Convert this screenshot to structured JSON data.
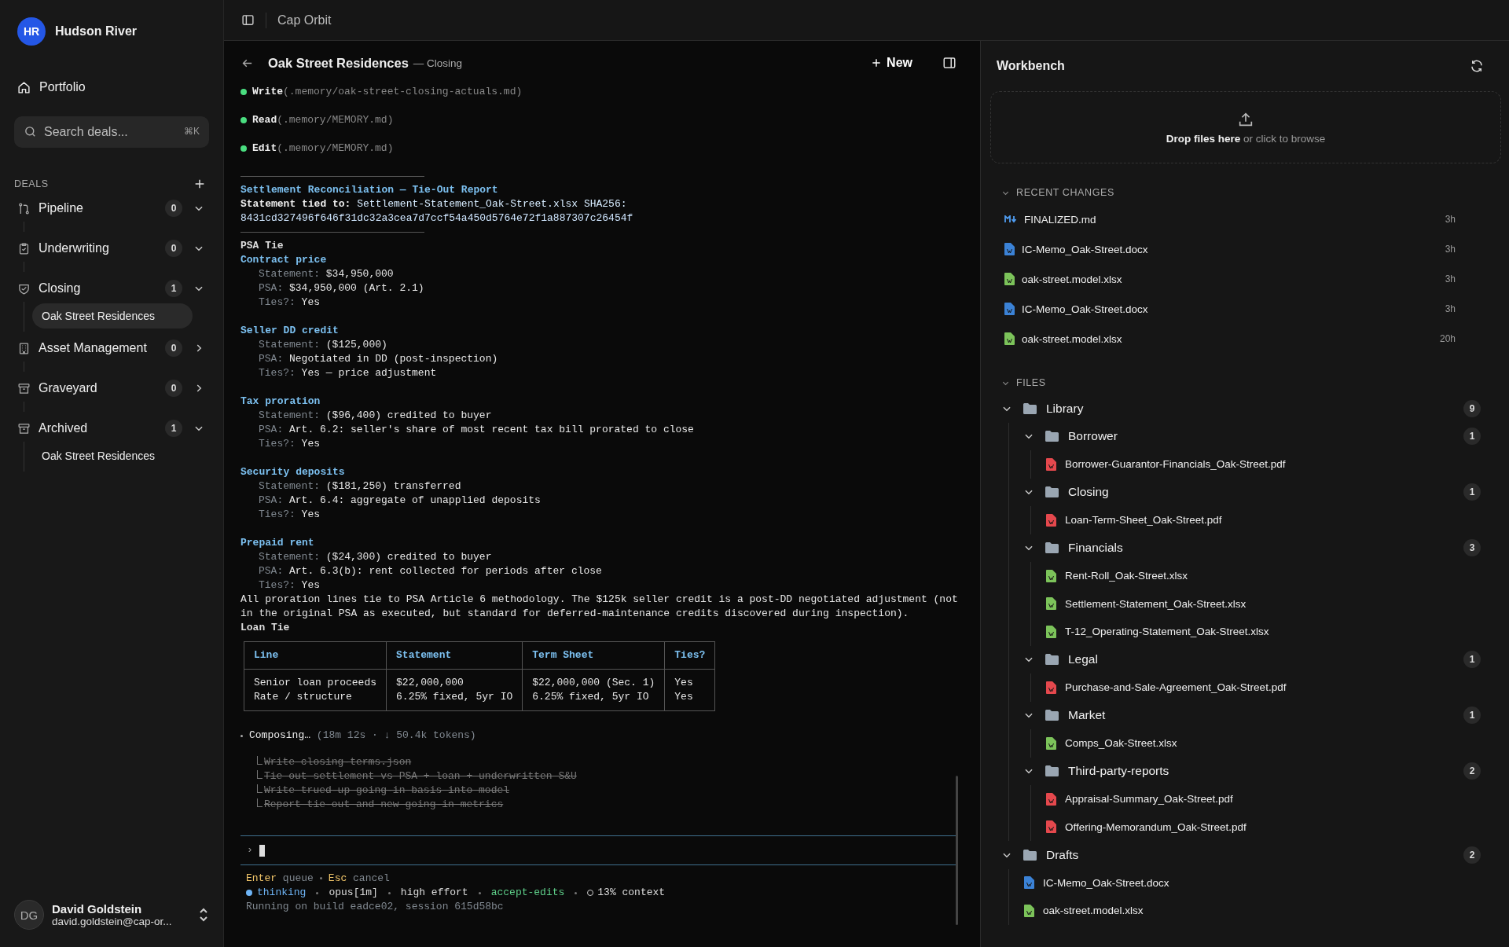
{
  "sidebar": {
    "org": {
      "initials": "HR",
      "name": "Hudson River"
    },
    "nav_item": "Portfolio",
    "search": {
      "placeholder": "Search deals...",
      "shortcut": "⌘K"
    },
    "deals": {
      "heading": "DEALS",
      "groups": [
        {
          "kind": "pipeline",
          "label": "Pipeline",
          "count": "0",
          "expanded": true
        },
        {
          "kind": "underwriting",
          "label": "Underwriting",
          "count": "0",
          "expanded": true
        },
        {
          "kind": "closing",
          "label": "Closing",
          "count": "1",
          "expanded": true,
          "children": [
            {
              "label": "Oak Street Residences",
              "selected": true
            }
          ]
        },
        {
          "kind": "asset",
          "label": "Asset Management",
          "count": "0",
          "expanded": false
        },
        {
          "kind": "graveyard",
          "label": "Graveyard",
          "count": "0",
          "expanded": false
        },
        {
          "kind": "archived",
          "label": "Archived",
          "count": "1",
          "expanded": true,
          "children": [
            {
              "label": "Oak Street Residences",
              "selected": false
            }
          ]
        }
      ]
    },
    "user": {
      "initials": "DG",
      "name": "David Goldstein",
      "email": "david.goldstein@cap-or..."
    }
  },
  "topbar": {
    "title": "Cap Orbit"
  },
  "chat": {
    "title": "Oak Street Residences",
    "subtitle": "— Closing",
    "new_button": "New",
    "tool_calls": [
      {
        "verb": "Write",
        "arg": "(.memory/oak-street-closing-actuals.md)"
      },
      {
        "verb": "Read",
        "arg": "(.memory/MEMORY.md)"
      },
      {
        "verb": "Edit",
        "arg": "(.memory/MEMORY.md)"
      }
    ],
    "report": [
      {
        "kind": "rule"
      },
      {
        "kind": "title",
        "text": "Settlement Reconciliation — Tie-Out Report"
      },
      {
        "kind": "meta",
        "label": "Statement tied to:",
        "value": "Settlement-Statement_Oak-Street.xlsx SHA256:"
      },
      {
        "kind": "hash",
        "text": "8431cd327496f646f31dc32a3cea7d7ccf54a450d5764e72f1a887307c26454f"
      },
      {
        "kind": "rule"
      },
      {
        "kind": "section",
        "text": "PSA Tie"
      },
      {
        "kind": "heading",
        "text": "Contract price"
      },
      {
        "kind": "field",
        "label": "Statement:",
        "value": "$34,950,000"
      },
      {
        "kind": "field",
        "label": "PSA:",
        "value": "$34,950,000 (Art. 2.1)"
      },
      {
        "kind": "field",
        "label": "Ties?:",
        "value": "Yes"
      },
      {
        "kind": "heading",
        "text": "Seller DD credit"
      },
      {
        "kind": "field",
        "label": "Statement:",
        "value": "($125,000)"
      },
      {
        "kind": "field",
        "label": "PSA:",
        "value": "Negotiated in DD (post-inspection)"
      },
      {
        "kind": "field",
        "label": "Ties?:",
        "value": "Yes — price adjustment"
      },
      {
        "kind": "heading",
        "text": "Tax proration"
      },
      {
        "kind": "field",
        "label": "Statement:",
        "value": "($96,400) credited to buyer"
      },
      {
        "kind": "field",
        "label": "PSA:",
        "value": "Art. 6.2: seller's share of most recent tax bill prorated to close"
      },
      {
        "kind": "field",
        "label": "Ties?:",
        "value": "Yes"
      },
      {
        "kind": "heading",
        "text": "Security deposits"
      },
      {
        "kind": "field",
        "label": "Statement:",
        "value": "($181,250) transferred"
      },
      {
        "kind": "field",
        "label": "PSA:",
        "value": "Art. 6.4: aggregate of unapplied deposits"
      },
      {
        "kind": "field",
        "label": "Ties?:",
        "value": "Yes"
      },
      {
        "kind": "heading",
        "text": "Prepaid rent"
      },
      {
        "kind": "field",
        "label": "Statement:",
        "value": "($24,300) credited to buyer"
      },
      {
        "kind": "field",
        "label": "PSA:",
        "value": "Art. 6.3(b): rent collected for periods after close"
      },
      {
        "kind": "field",
        "label": "Ties?:",
        "value": "Yes"
      },
      {
        "kind": "note",
        "text": "All proration lines tie to PSA Article 6 methodology. The $125k seller credit is a post-DD negotiated adjustment (not in the original PSA as executed, but standard for deferred-maintenance credits discovered during inspection)."
      },
      {
        "kind": "section",
        "text": "Loan Tie"
      }
    ],
    "table": {
      "columns": [
        "Line",
        "Statement",
        "Term Sheet",
        "Ties?"
      ],
      "rows": [
        [
          "Senior loan proceeds",
          "$22,000,000",
          "$22,000,000 (Sec. 1)",
          "Yes"
        ],
        [
          "Rate / structure",
          "6.25% fixed, 5yr IO",
          "6.25% fixed, 5yr IO",
          "Yes"
        ]
      ]
    },
    "progress": {
      "label": "Composing…",
      "detail": "(18m 12s · ↓ 50.4k tokens)",
      "tasks": [
        {
          "text": "Write closing-terms.json",
          "done": true
        },
        {
          "text": "Tie out settlement vs PSA + loan + underwritten S&U",
          "done": true
        },
        {
          "text": "Write trued-up going-in basis into model",
          "done": true
        },
        {
          "text": "Report tie-out and new going-in metrics",
          "done": true
        }
      ]
    },
    "prompt": {
      "symbol": "›"
    },
    "footer": {
      "hints": [
        {
          "key": "Enter",
          "action": "queue"
        },
        {
          "key": "Esc",
          "action": "cancel"
        }
      ],
      "status": [
        {
          "kind": "mode",
          "text": "thinking"
        },
        {
          "kind": "plain",
          "text": "opus[1m]"
        },
        {
          "kind": "plain",
          "text": "high effort"
        },
        {
          "kind": "accent",
          "text": "accept-edits"
        },
        {
          "kind": "context",
          "text": "13% context"
        }
      ],
      "build": "Running on build eadce02, session 615d58bc"
    }
  },
  "workbench": {
    "title": "Workbench",
    "dropzone": "**Drop files here** or click to browse",
    "recent": {
      "heading": "RECENT CHANGES",
      "expanded": true,
      "items": [
        {
          "kind": "md",
          "name": "FINALIZED.md",
          "time": "3h"
        },
        {
          "kind": "docx",
          "name": "IC-Memo_Oak-Street.docx",
          "time": "3h"
        },
        {
          "kind": "xlsx",
          "name": "oak-street.model.xlsx",
          "time": "3h"
        },
        {
          "kind": "docx",
          "name": "IC-Memo_Oak-Street.docx",
          "time": "3h"
        },
        {
          "kind": "xlsx",
          "name": "oak-street.model.xlsx",
          "time": "20h"
        }
      ]
    },
    "files": {
      "heading": "FILES",
      "expanded": true,
      "tree": [
        {
          "kind": "folder",
          "name": "Library",
          "count": "9",
          "expanded": true,
          "children": [
            {
              "kind": "folder",
              "name": "Borrower",
              "count": "1",
              "expanded": true,
              "children": [
                {
                  "kind": "pdf",
                  "name": "Borrower-Guarantor-Financials_Oak-Street.pdf"
                }
              ]
            },
            {
              "kind": "folder",
              "name": "Closing",
              "count": "1",
              "expanded": true,
              "children": [
                {
                  "kind": "pdf",
                  "name": "Loan-Term-Sheet_Oak-Street.pdf"
                }
              ]
            },
            {
              "kind": "folder",
              "name": "Financials",
              "count": "3",
              "expanded": true,
              "children": [
                {
                  "kind": "xlsx",
                  "name": "Rent-Roll_Oak-Street.xlsx"
                },
                {
                  "kind": "xlsx",
                  "name": "Settlement-Statement_Oak-Street.xlsx"
                },
                {
                  "kind": "xlsx",
                  "name": "T-12_Operating-Statement_Oak-Street.xlsx"
                }
              ]
            },
            {
              "kind": "folder",
              "name": "Legal",
              "count": "1",
              "expanded": true,
              "children": [
                {
                  "kind": "pdf",
                  "name": "Purchase-and-Sale-Agreement_Oak-Street.pdf"
                }
              ]
            },
            {
              "kind": "folder",
              "name": "Market",
              "count": "1",
              "expanded": true,
              "children": [
                {
                  "kind": "xlsx",
                  "name": "Comps_Oak-Street.xlsx"
                }
              ]
            },
            {
              "kind": "folder",
              "name": "Third-party-reports",
              "count": "2",
              "expanded": true,
              "children": [
                {
                  "kind": "pdf",
                  "name": "Appraisal-Summary_Oak-Street.pdf"
                },
                {
                  "kind": "pdf",
                  "name": "Offering-Memorandum_Oak-Street.pdf"
                }
              ]
            }
          ]
        },
        {
          "kind": "folder",
          "name": "Drafts",
          "count": "2",
          "expanded": true,
          "children": [
            {
              "kind": "docx",
              "name": "IC-Memo_Oak-Street.docx"
            },
            {
              "kind": "xlsx",
              "name": "oak-street.model.xlsx"
            }
          ]
        }
      ]
    }
  }
}
